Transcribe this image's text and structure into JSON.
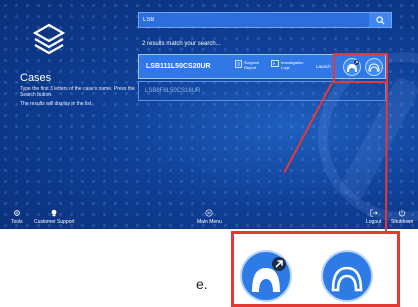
{
  "app": {
    "side": {
      "title": "Cases",
      "instruction1": "Type the first 3 letters of the case's name. Press the Search button.",
      "instruction2": "The results will display in the list."
    },
    "search": {
      "value": "LSB",
      "icon": "search-icon"
    },
    "results": {
      "count_text": "2 results match your search...",
      "cases": [
        {
          "id": "LSB111L50CS20UR",
          "selected": true,
          "surgeon_report": "Surgeon Report",
          "investigation_logs": "Investigation Logs",
          "launch_label": "Launch"
        },
        {
          "id": "LSB8F8L50CS18UR",
          "selected": false
        }
      ]
    },
    "bottom_bar": {
      "tools": "Tools",
      "customer_support": "Customer Support",
      "main_menu": "Main Menu",
      "logout": "Logout",
      "shutdown": "Shutdown"
    }
  },
  "callout": {
    "launch_planning_icon": "femur-with-arrow-icon",
    "launch_tibia_icon": "tibia-icon",
    "accent_color": "#e53935"
  },
  "caption": "e."
}
